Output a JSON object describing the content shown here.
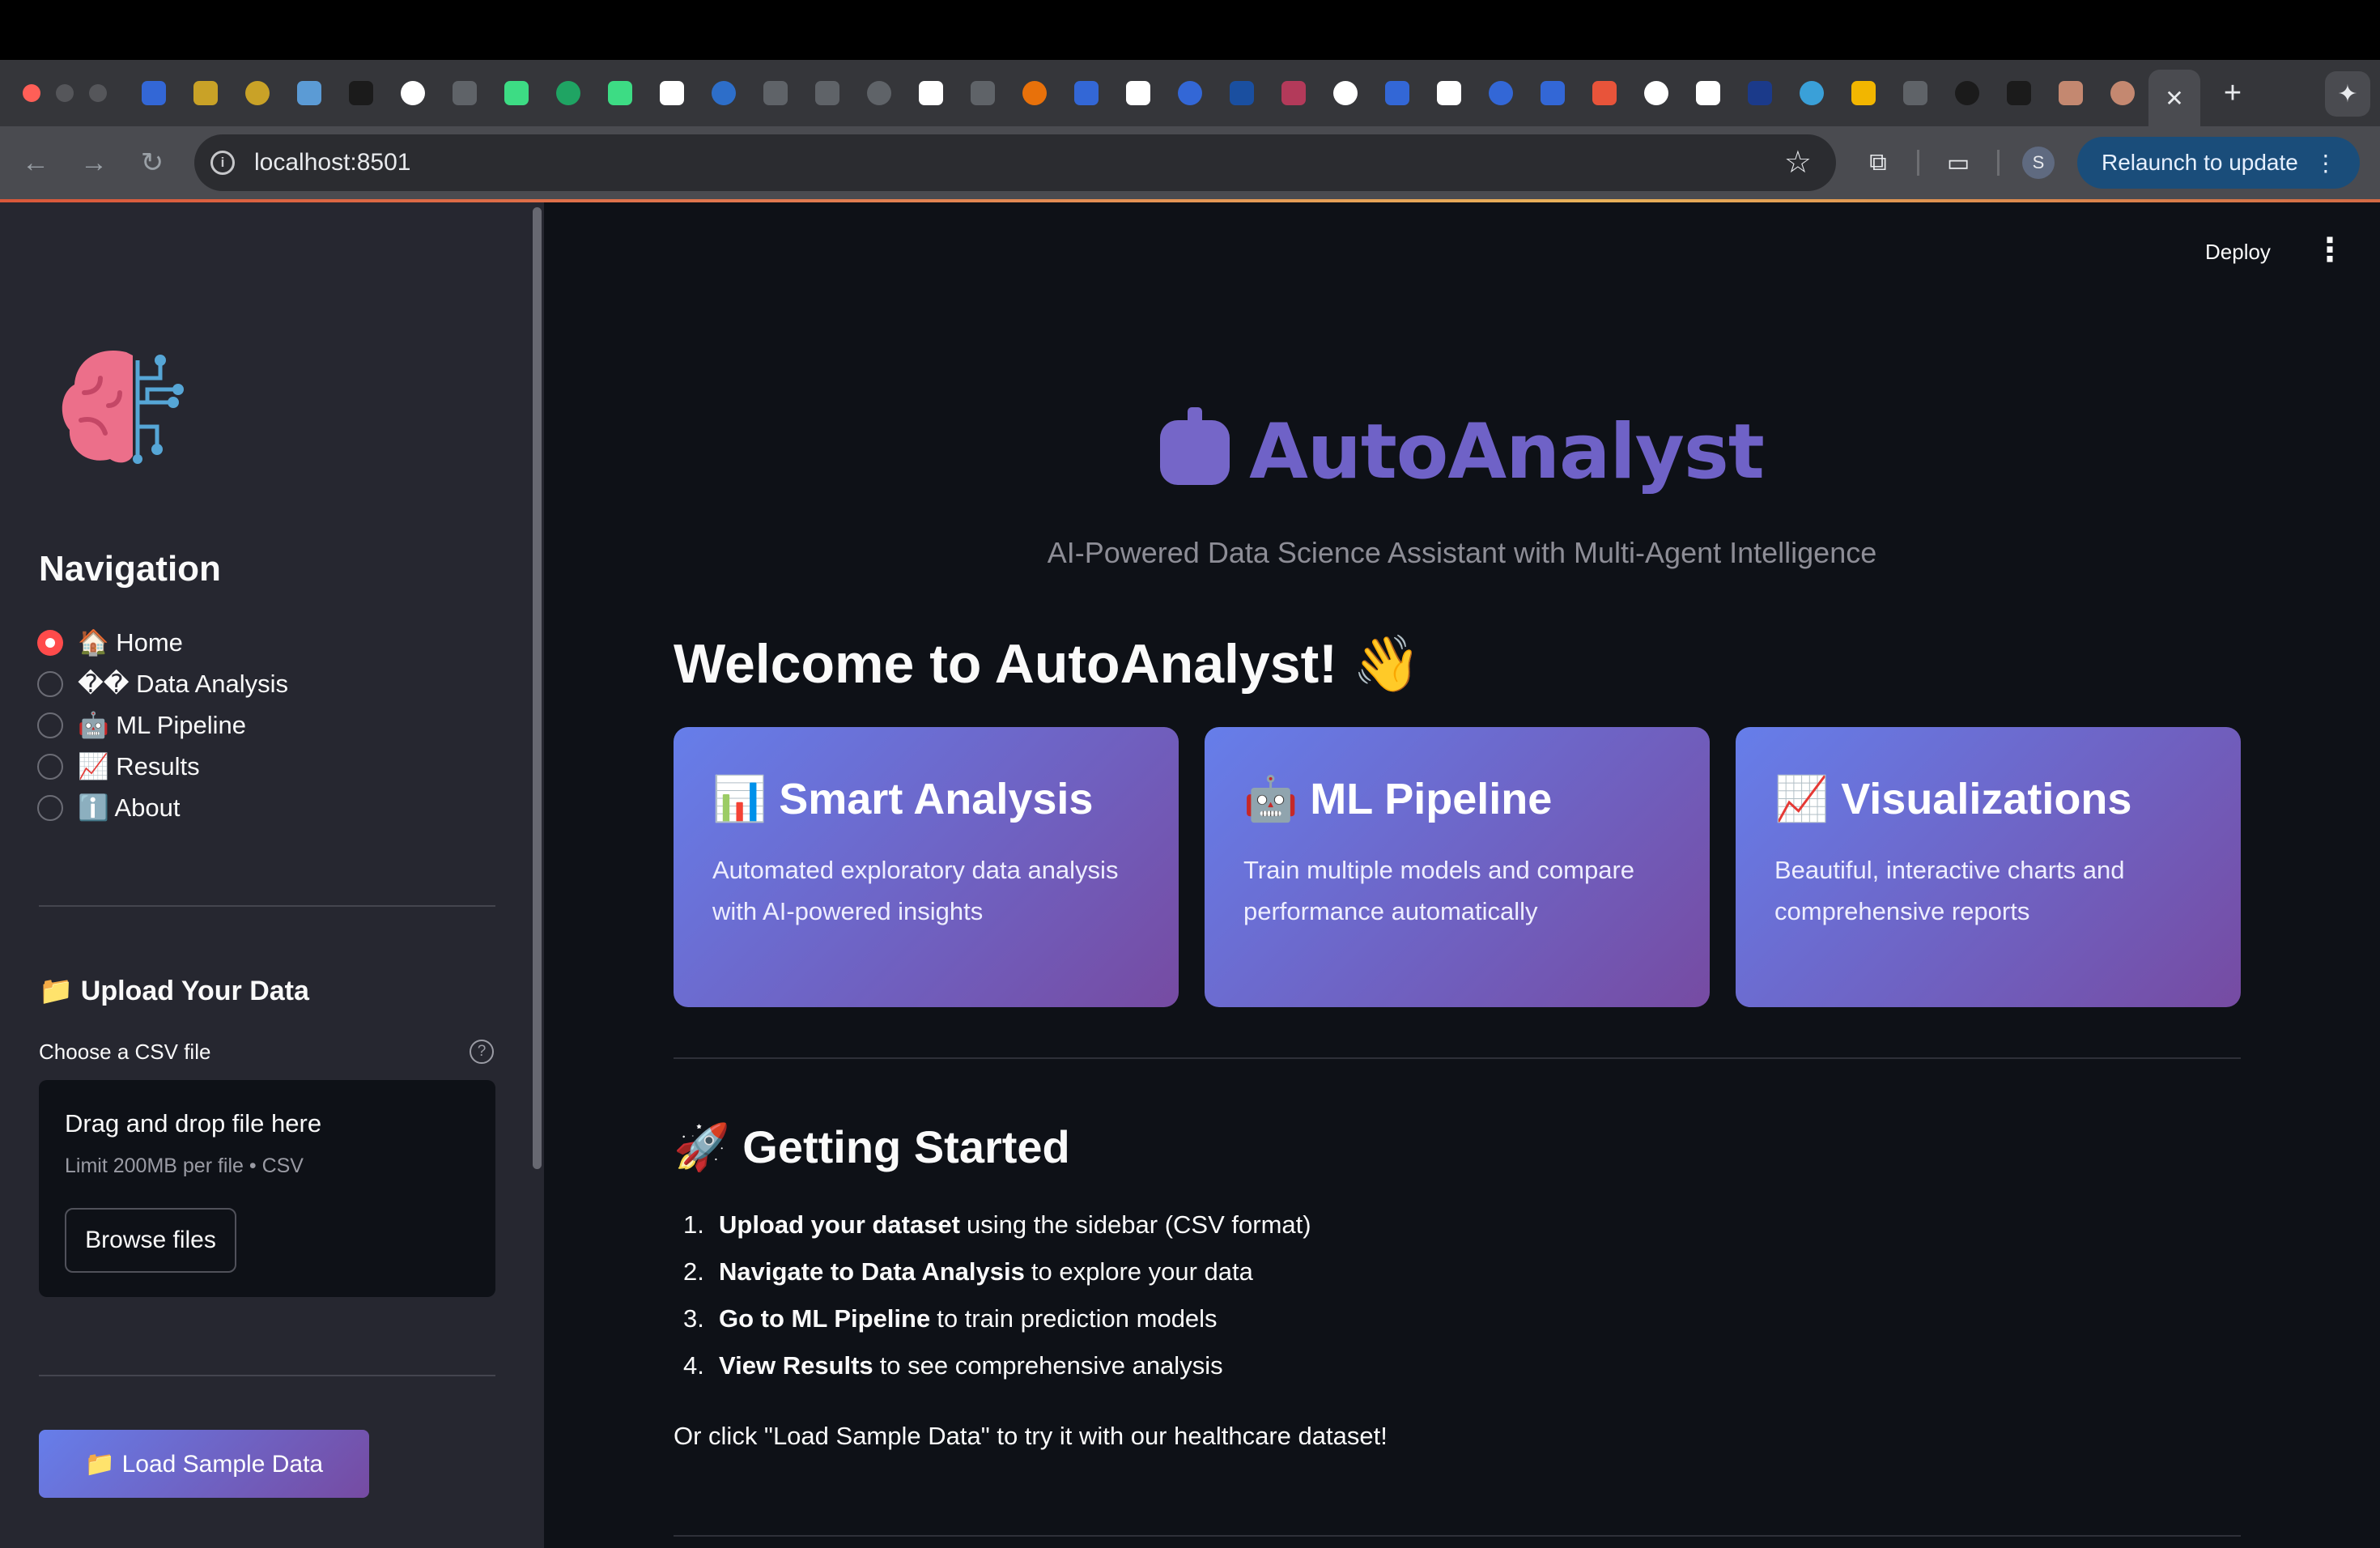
{
  "browser": {
    "url": "localhost:8501",
    "active_tab_close": "✕",
    "new_tab": "+",
    "profile_initial": "S",
    "relaunch_label": "Relaunch to update",
    "favicon_colors": [
      "#3367d6",
      "#c9a227",
      "#c9a227",
      "#5b9bd5",
      "#1b1b1b",
      "#ffffff",
      "#5f6368",
      "#3ddc84",
      "#1fa463",
      "#3ddc84",
      "#ffffff",
      "#2d6ec9",
      "#5f6368",
      "#5f6368",
      "#5f6368",
      "#ffffff",
      "#5f6368",
      "#e8710a",
      "#3367d6",
      "#ffffff",
      "#3367d6",
      "#1a4fa0",
      "#b33a5a",
      "#ffffff",
      "#3367d6",
      "#ffffff",
      "#3367d6",
      "#3367d6",
      "#e8543a",
      "#ffffff",
      "#ffffff",
      "#1b3a8a",
      "#3aa0d8",
      "#f2b600",
      "#5f6368",
      "#1b1b1b",
      "#1b1b1b",
      "#c48870",
      "#c48870"
    ]
  },
  "app": {
    "deploy_label": "Deploy",
    "menu_icon": "⋮",
    "sidebar": {
      "logo": "brain-circuit-logo",
      "nav_title": "Navigation",
      "nav_items": [
        {
          "label": "🏠 Home",
          "selected": true
        },
        {
          "label": "�� Data Analysis",
          "selected": false
        },
        {
          "label": "🤖 ML Pipeline",
          "selected": false
        },
        {
          "label": "📈 Results",
          "selected": false
        },
        {
          "label": "ℹ️ About",
          "selected": false
        }
      ],
      "upload_heading": "📁 Upload Your Data",
      "upload_label": "Choose a CSV file",
      "help_icon": "?",
      "dropzone_title": "Drag and drop file here",
      "dropzone_limit": "Limit 200MB per file • CSV",
      "browse_label": "Browse files",
      "load_sample_label": "📁 Load Sample Data"
    },
    "hero": {
      "title": "AutoAnalyst",
      "subtitle": "AI-Powered Data Science Assistant with Multi-Agent Intelligence"
    },
    "welcome": "Welcome to AutoAnalyst! 👋",
    "cards": [
      {
        "title": "📊 Smart Analysis",
        "desc": "Automated exploratory data analysis with AI-powered insights"
      },
      {
        "title": "🤖 ML Pipeline",
        "desc": "Train multiple models and compare performance automatically"
      },
      {
        "title": "📈 Visualizations",
        "desc": "Beautiful, interactive charts and comprehensive reports"
      }
    ],
    "getting_started": {
      "title": "🚀 Getting Started",
      "steps": [
        {
          "num": "1.",
          "bold": "Upload your dataset",
          "rest": "using the sidebar (CSV format)"
        },
        {
          "num": "2.",
          "bold": "Navigate to Data Analysis",
          "rest": "to explore your data"
        },
        {
          "num": "3.",
          "bold": "Go to ML Pipeline",
          "rest": "to train prediction models"
        },
        {
          "num": "4.",
          "bold": "View Results",
          "rest": "to see comprehensive analysis"
        }
      ],
      "cta": "Or click \"Load Sample Data\" to try it with our healthcare dataset!"
    }
  }
}
